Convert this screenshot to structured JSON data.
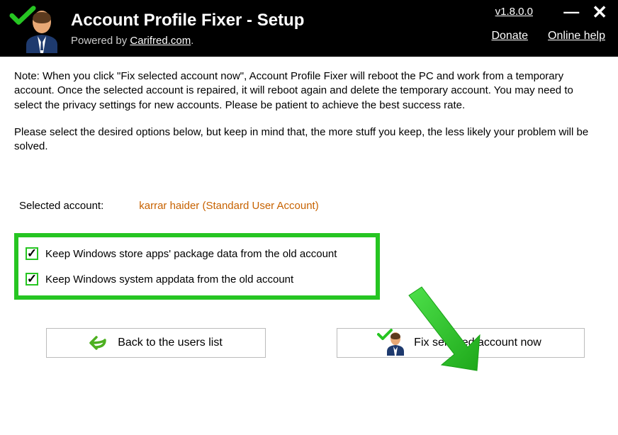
{
  "header": {
    "title": "Account Profile Fixer - Setup",
    "powered_prefix": "Powered by ",
    "powered_link": "Carifred.com",
    "powered_suffix": ".",
    "version": "v1.8.0.0",
    "donate": "Donate",
    "online_help": "Online help"
  },
  "content": {
    "note1": "Note: When you click \"Fix selected account now\", Account Profile Fixer will reboot the PC and work from a temporary account. Once the selected account is repaired, it will reboot again and delete the temporary account. You may need to select the privacy settings for new accounts. Please be patient to achieve the best success rate.",
    "note2": "Please select the desired options below, but keep in mind that, the more stuff you keep, the less likely your problem will be solved.",
    "selected_label": "Selected account:",
    "selected_value": "karrar haider (Standard User Account)",
    "option1": "Keep Windows store apps' package data from the old account",
    "option2": "Keep Windows system appdata from the old account"
  },
  "buttons": {
    "back": "Back to the users list",
    "fix": "Fix selected account now"
  }
}
